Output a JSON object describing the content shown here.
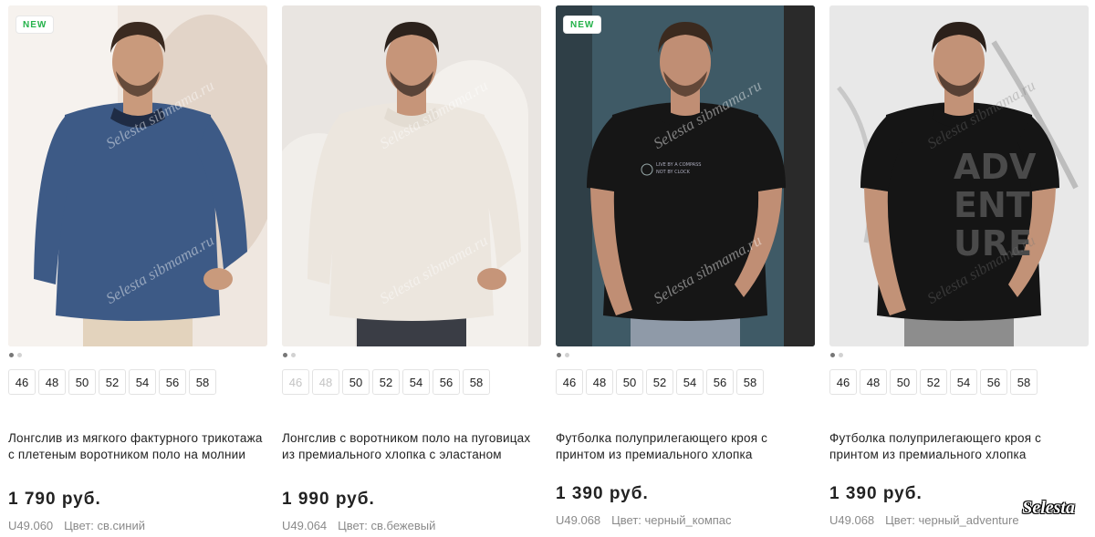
{
  "products": [
    {
      "badge": "NEW",
      "sizes": [
        {
          "label": "46",
          "available": true
        },
        {
          "label": "48",
          "available": true
        },
        {
          "label": "50",
          "available": true
        },
        {
          "label": "52",
          "available": true
        },
        {
          "label": "54",
          "available": true
        },
        {
          "label": "56",
          "available": true
        },
        {
          "label": "58",
          "available": true
        }
      ],
      "title": "Лонгслив из мягкого фактурного трикотажа с плетеным воротником поло на молнии",
      "price": "1 790 руб.",
      "sku": "U49.060",
      "color": "Цвет: св.синий",
      "colors": {
        "bg": "#efe7e0",
        "shirt": "#3d5a86",
        "collar": "#1f2c45",
        "skin": "#c99a7c",
        "hair": "#3a2a20",
        "pants": "#e3d3bd"
      }
    },
    {
      "badge": "",
      "sizes": [
        {
          "label": "46",
          "available": false
        },
        {
          "label": "48",
          "available": false
        },
        {
          "label": "50",
          "available": true
        },
        {
          "label": "52",
          "available": true
        },
        {
          "label": "54",
          "available": true
        },
        {
          "label": "56",
          "available": true
        },
        {
          "label": "58",
          "available": true
        }
      ],
      "title": "Лонгслив с воротником поло на пуговицах из премиального хлопка с эластаном",
      "price": "1 990 руб.",
      "sku": "U49.064",
      "color": "Цвет: св.бежевый",
      "colors": {
        "bg": "#e9e5e1",
        "shirt": "#ece6de",
        "collar": "#e3dcd2",
        "skin": "#c69579",
        "hair": "#2c221c",
        "pants": "#3a3d45"
      }
    },
    {
      "badge": "NEW",
      "sizes": [
        {
          "label": "46",
          "available": true
        },
        {
          "label": "48",
          "available": true
        },
        {
          "label": "50",
          "available": true
        },
        {
          "label": "52",
          "available": true
        },
        {
          "label": "54",
          "available": true
        },
        {
          "label": "56",
          "available": true
        },
        {
          "label": "58",
          "available": true
        }
      ],
      "title": "Футболка полуприлегающего кроя с принтом из премиального хлопка",
      "price": "1 390 руб.",
      "sku": "U49.068",
      "color": "Цвет: черный_компас",
      "print_text": "LIVE BY A COMPASS NOT BY CLOCK",
      "colors": {
        "bg": "#3f5a66",
        "shirt": "#161616",
        "collar": "#161616",
        "skin": "#c08e74",
        "hair": "#3b2a1f",
        "pants": "#8f9aa8"
      }
    },
    {
      "badge": "",
      "sizes": [
        {
          "label": "46",
          "available": true
        },
        {
          "label": "48",
          "available": true
        },
        {
          "label": "50",
          "available": true
        },
        {
          "label": "52",
          "available": true
        },
        {
          "label": "54",
          "available": true
        },
        {
          "label": "56",
          "available": true
        },
        {
          "label": "58",
          "available": true
        }
      ],
      "title": "Футболка полуприлегающего кроя с принтом из премиального хлопка",
      "price": "1 390 руб.",
      "sku": "U49.068",
      "color": "Цвет: черный_adventure",
      "print_text": "ADV ENT URE",
      "colors": {
        "bg": "#e8e8e8",
        "shirt": "#151515",
        "collar": "#151515",
        "skin": "#c29277",
        "hair": "#2b201a",
        "pants": "#8d8d8d"
      }
    }
  ],
  "watermarks": {
    "site": "sibmama.ru",
    "brand": "Selesta sibmama.ru",
    "corner": "Selesta"
  }
}
